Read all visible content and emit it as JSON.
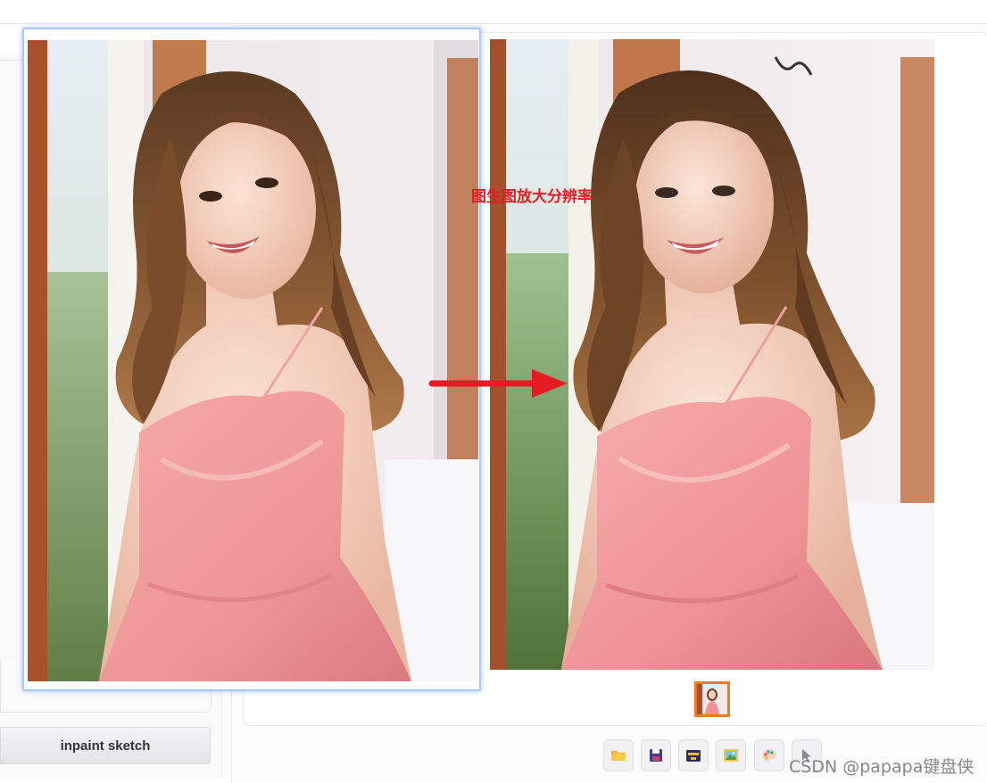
{
  "left_panel": {
    "inpaint_sketch_label": "inpaint sketch"
  },
  "annotation": {
    "caption": "图生图放大分辨率",
    "caption_color": "#e51c23",
    "arrow_color": "#e51c23"
  },
  "gallery": {
    "selected_thumb_border": "#f07a20"
  },
  "toolbar": {
    "icons": [
      "folder-icon",
      "save-icon",
      "archive-icon",
      "image-icon",
      "palette-icon",
      "cursor-icon"
    ]
  },
  "watermark": {
    "text": "CSDN @papapa键盘侠"
  }
}
